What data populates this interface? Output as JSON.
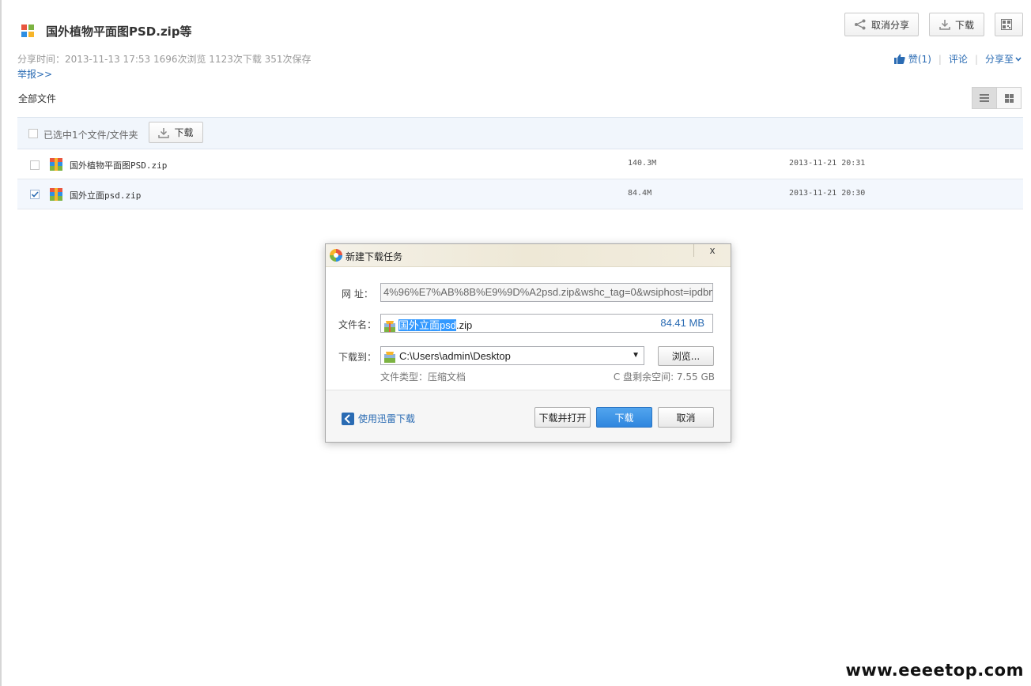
{
  "header": {
    "title": "国外植物平面图PSD.zip等",
    "cancel_share": "取消分享",
    "download": "下载",
    "meta": "分享时间：2013-11-13 17:53  1696次浏览  1123次下载  351次保存",
    "report": "举报>>",
    "like": "赞(1)",
    "comment": "评论",
    "share_to": "分享至"
  },
  "list": {
    "section_label": "全部文件",
    "selected_label": "已选中1个文件/文件夹",
    "download_label": "下载",
    "rows": [
      {
        "name": "国外植物平面图PSD.zip",
        "size": "140.3M",
        "date": "2013-11-21 20:31",
        "checked": false
      },
      {
        "name": "国外立面psd.zip",
        "size": "84.4M",
        "date": "2013-11-21 20:30",
        "checked": true
      }
    ]
  },
  "dialog": {
    "title": "新建下载任务",
    "close": "x",
    "url_label": "网  址：",
    "url_value": "4%96%E7%AB%8B%E9%9D%A2psd.zip&wshc_tag=0&wsiphost=ipdbm",
    "name_label": "文件名：",
    "name_highlight": "国外立面psd",
    "name_ext": ".zip",
    "file_size": "84.41 MB",
    "dest_label": "下载到：",
    "dest_value": "C:\\Users\\admin\\Desktop",
    "browse": "浏览...",
    "file_type": "文件类型：压缩文档",
    "free_space": "C 盘剩余空间: 7.55 GB",
    "thunder_link": "使用迅雷下载",
    "download_open": "下载并打开",
    "download": "下载",
    "cancel": "取消"
  },
  "watermark": "www.eeeetop.com",
  "colors": {
    "link": "#2a6bb3",
    "primary_button": "#3a8fe3",
    "selection": "#3399ff"
  }
}
